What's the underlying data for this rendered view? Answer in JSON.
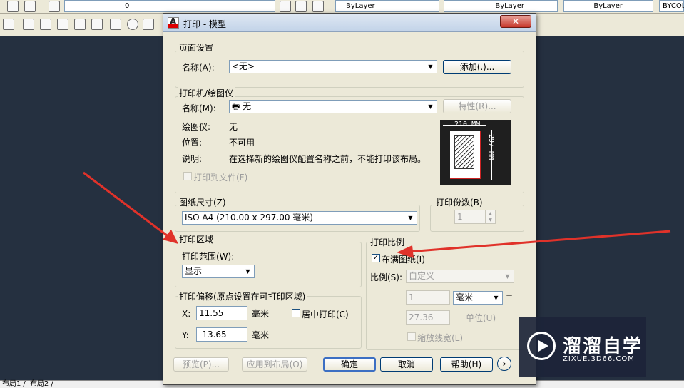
{
  "toolbar": {
    "layer_value": "0",
    "color_value": "ByLayer",
    "linetype_value": "ByLayer",
    "lineweight_value": "ByLayer",
    "plotstyle_value": "BYCOL"
  },
  "layout_tabs": [
    "布局1",
    "布局2"
  ],
  "dialog": {
    "title": "打印 - 模型",
    "close_label": "✕",
    "page_setup": {
      "group_label": "页面设置",
      "name_label": "名称(A):",
      "name_value": "<无>",
      "add_button": "添加(.)..."
    },
    "printer": {
      "group_label": "打印机/绘图仪",
      "name_label": "名称(M):",
      "name_value": "无",
      "properties_button": "特性(R)...",
      "plotter_label": "绘图仪:",
      "plotter_value": "无",
      "location_label": "位置:",
      "location_value": "不可用",
      "description_label": "说明:",
      "description_value": "在选择新的绘图仪配置名称之前，不能打印该布局。",
      "print_to_file_label": "打印到文件(F)",
      "preview_width": "210 MM",
      "preview_height": "297 MM"
    },
    "paper_size": {
      "group_label": "图纸尺寸(Z)",
      "value": "ISO A4 (210.00 x 297.00 毫米)"
    },
    "copies": {
      "group_label": "打印份数(B)",
      "value": "1"
    },
    "plot_area": {
      "group_label": "打印区域",
      "range_label": "打印范围(W):",
      "range_value": "显示"
    },
    "plot_offset": {
      "group_label": "打印偏移(原点设置在可打印区域)",
      "x_label": "X:",
      "x_value": "11.55",
      "x_unit": "毫米",
      "y_label": "Y:",
      "y_value": "-13.65",
      "y_unit": "毫米",
      "center_label": "居中打印(C)"
    },
    "plot_scale": {
      "group_label": "打印比例",
      "fit_label": "布满图纸(I)",
      "fit_checked": true,
      "scale_label": "比例(S):",
      "scale_value": "自定义",
      "value1": "1",
      "unit_value": "毫米",
      "equals": "=",
      "value2": "27.36",
      "unit_label": "单位(U)",
      "scale_lineweights_label": "缩放线宽(L)"
    },
    "buttons": {
      "preview": "预览(P)...",
      "apply_layout": "应用到布局(O)",
      "ok": "确定",
      "cancel": "取消",
      "help": "帮助(H)",
      "more": "›"
    }
  },
  "watermark": {
    "brand_cn": "溜溜自学",
    "url": "ZIXUE.3D66.COM"
  }
}
